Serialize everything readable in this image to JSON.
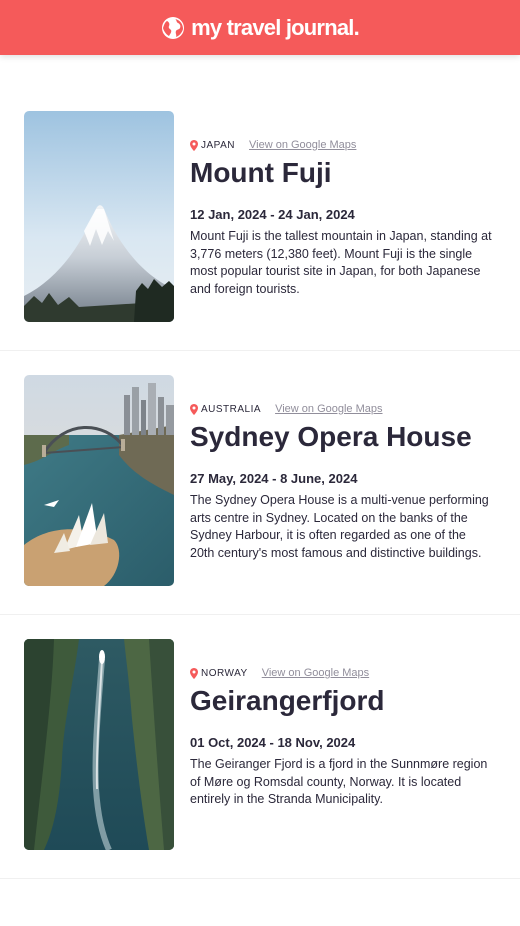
{
  "header": {
    "brand_text": "my travel journal.",
    "icon": "globe-icon",
    "bg_color": "#f55a5a"
  },
  "entries": [
    {
      "country": "JAPAN",
      "maps_link": "View on Google Maps",
      "title": "Mount Fuji",
      "dates": "12 Jan, 2024 - 24 Jan, 2024",
      "description": "Mount Fuji is the tallest mountain in Japan, standing at 3,776 meters (12,380 feet). Mount Fuji is the single most popular tourist site in Japan, for both Japanese and foreign tourists."
    },
    {
      "country": "AUSTRALIA",
      "maps_link": "View on Google Maps",
      "title": "Sydney Opera House",
      "dates": "27 May, 2024 - 8 June, 2024",
      "description": "The Sydney Opera House is a multi-venue performing arts centre in Sydney. Located on the banks of the Sydney Harbour, it is often regarded as one of the 20th century's most famous and distinctive buildings."
    },
    {
      "country": "NORWAY",
      "maps_link": "View on Google Maps",
      "title": "Geirangerfjord",
      "dates": "01 Oct, 2024 - 18 Nov, 2024",
      "description": "The Geiranger Fjord is a fjord in the Sunnmøre region of Møre og Romsdal county, Norway. It is located entirely in the Stranda Municipality."
    }
  ],
  "colors": {
    "accent": "#f55a5a",
    "text": "#2b283a",
    "muted": "#918e9b"
  }
}
